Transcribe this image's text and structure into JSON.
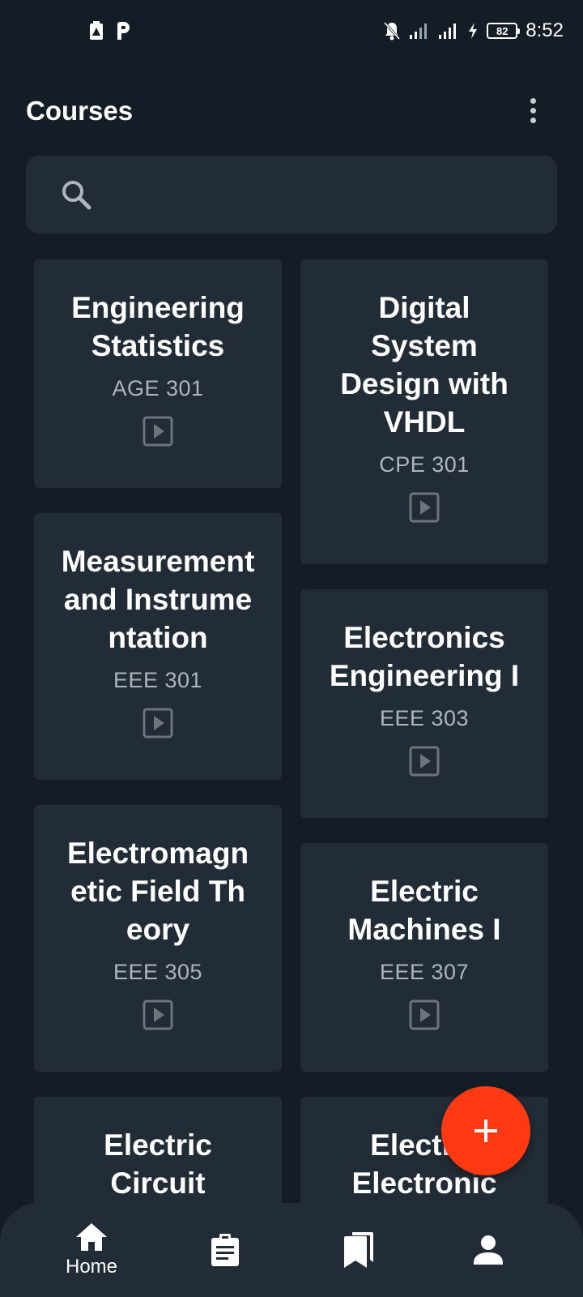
{
  "status_bar": {
    "time": "8:52",
    "battery": "82",
    "icons": [
      "notification-icon",
      "p-app-icon",
      "muted-bell-icon",
      "signal-icon",
      "signal-icon",
      "charging-icon"
    ]
  },
  "header": {
    "title": "Courses",
    "menu_icon": "more-vert-icon"
  },
  "search": {
    "placeholder": "",
    "icon": "search-icon"
  },
  "courses": [
    {
      "title": "Engineering Statistics",
      "code": "AGE 301"
    },
    {
      "title": "Digital System Design with VHDL",
      "code": "CPE 301"
    },
    {
      "title": "Measurement and Instrumentation",
      "code": "EEE 301"
    },
    {
      "title": "Electronics Engineering I",
      "code": "EEE 303"
    },
    {
      "title": "Electromagnetic Field Theory",
      "code": "EEE 305"
    },
    {
      "title": "Electric Machines I",
      "code": "EEE 307"
    },
    {
      "title": "Electric Circuit",
      "code": ""
    },
    {
      "title": "Electric Electronic",
      "code": ""
    }
  ],
  "fab": {
    "icon": "plus-icon"
  },
  "bottom_nav": [
    {
      "label": "Home",
      "icon": "home-icon"
    },
    {
      "label": "",
      "icon": "assignment-icon"
    },
    {
      "label": "",
      "icon": "bookmarks-icon"
    },
    {
      "label": "",
      "icon": "person-icon"
    }
  ],
  "colors": {
    "background": "#141d25",
    "card": "#222c36",
    "fab": "#ff3a12",
    "secondary_text": "#aeb6bd"
  }
}
